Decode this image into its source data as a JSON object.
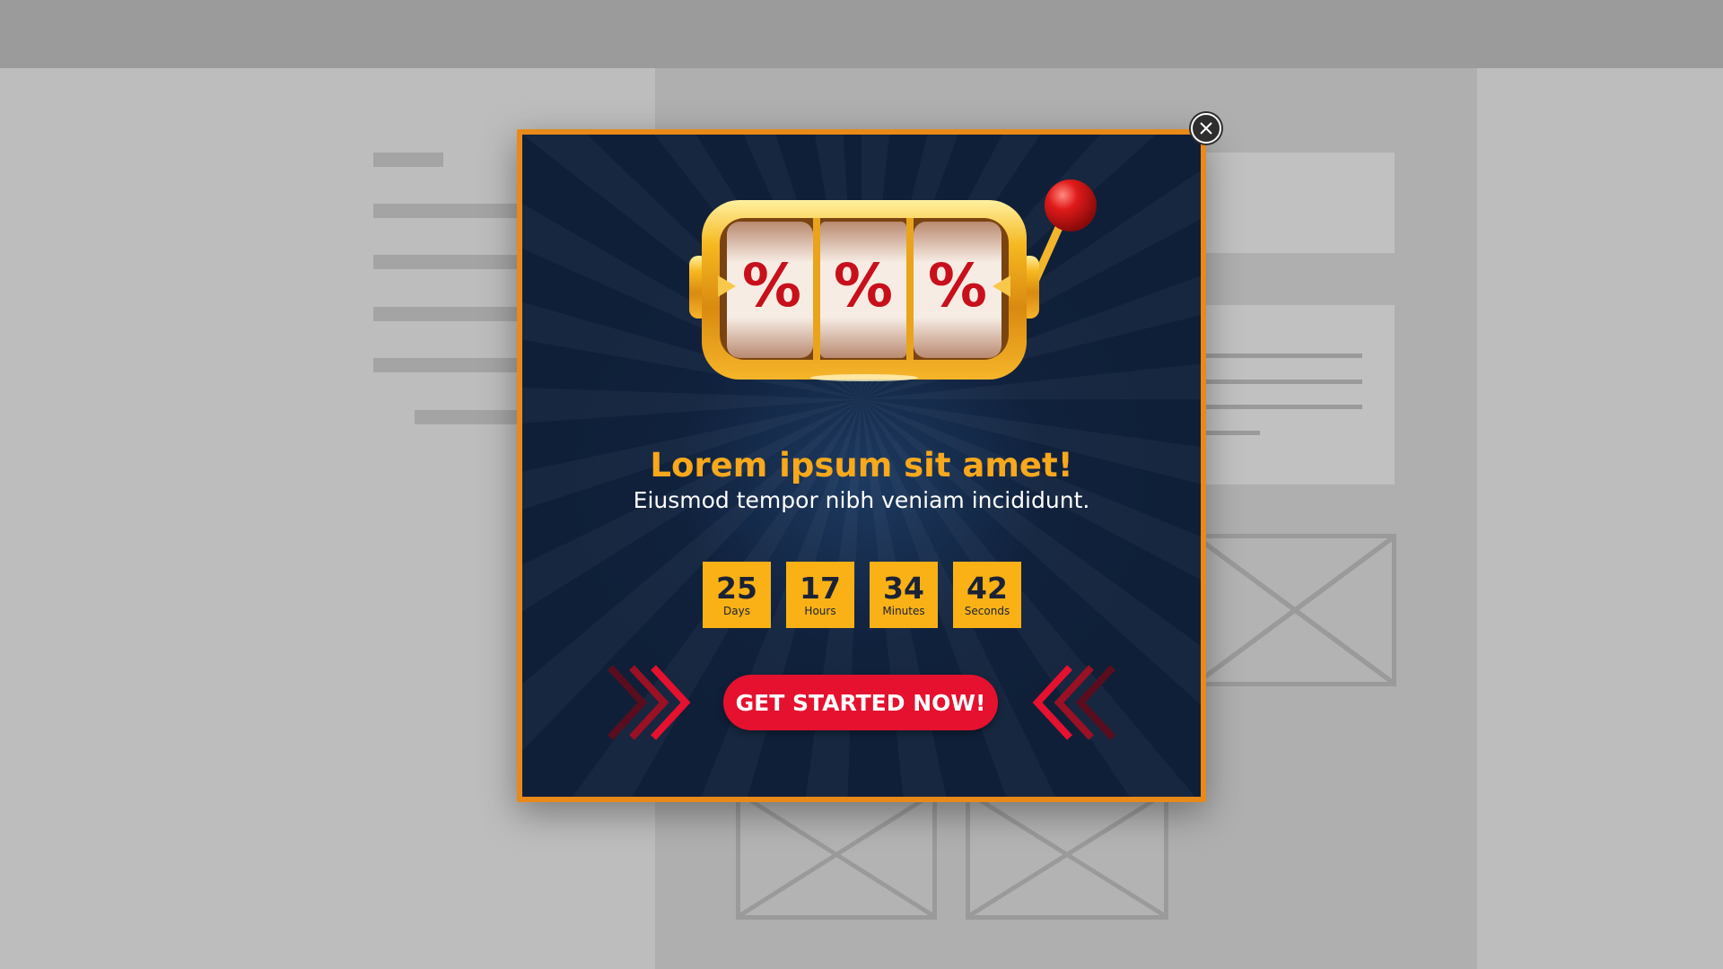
{
  "popup": {
    "headline": "Lorem ipsum sit amet!",
    "subline": "Eiusmod tempor nibh veniam incididunt.",
    "reel_symbol": "%",
    "countdown": [
      {
        "value": "25",
        "label": "Days"
      },
      {
        "value": "17",
        "label": "Hours"
      },
      {
        "value": "34",
        "label": "Minutes"
      },
      {
        "value": "42",
        "label": "Seconds"
      }
    ],
    "cta_label": "GET STARTED NOW!",
    "close_icon": "close-icon"
  },
  "colors": {
    "accent_gold": "#f7a81b",
    "countdown_bg": "#f9b116",
    "cta_red": "#e5112e",
    "popup_bg": "#0f1f38",
    "frame_orange": "#e8891a"
  }
}
